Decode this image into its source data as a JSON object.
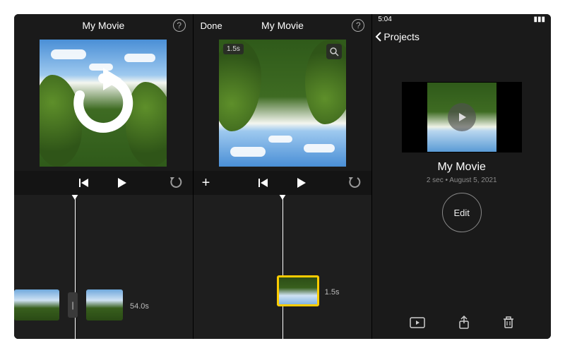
{
  "col1": {
    "title": "My Movie",
    "help": "?",
    "clip_duration_label": "54.0s",
    "gap_glyph": "|"
  },
  "col2": {
    "done": "Done",
    "title": "My Movie",
    "help": "?",
    "preview_duration_badge": "1.5s",
    "clip_duration_label": "1.5s",
    "plus": "+"
  },
  "col3": {
    "status_time": "5:04",
    "back_label": "Projects",
    "project_title": "My Movie",
    "project_sub": "2 sec • August 5, 2021",
    "edit_label": "Edit"
  }
}
